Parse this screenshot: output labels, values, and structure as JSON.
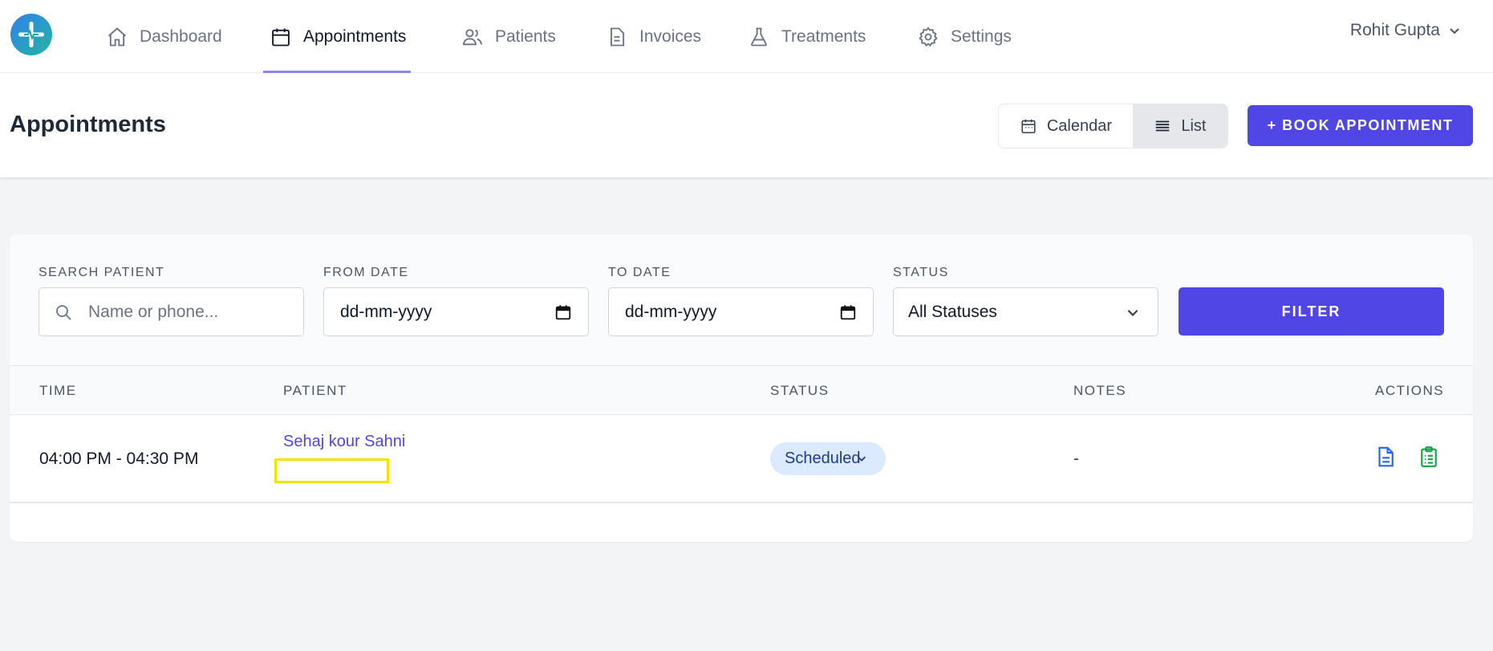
{
  "nav": {
    "items": [
      {
        "label": "Dashboard",
        "icon": "home-icon"
      },
      {
        "label": "Appointments",
        "icon": "calendar-icon",
        "active": true
      },
      {
        "label": "Patients",
        "icon": "users-icon"
      },
      {
        "label": "Invoices",
        "icon": "document-icon"
      },
      {
        "label": "Treatments",
        "icon": "flask-icon"
      },
      {
        "label": "Settings",
        "icon": "gear-icon"
      }
    ],
    "user_name": "Rohit Gupta"
  },
  "header": {
    "title": "Appointments",
    "view_calendar": "Calendar",
    "view_list": "List",
    "book_button": "+ BOOK APPOINTMENT"
  },
  "filters": {
    "search_label": "SEARCH PATIENT",
    "search_placeholder": "Name or phone...",
    "from_label": "FROM DATE",
    "from_value": "dd-mm-yyyy",
    "to_label": "TO DATE",
    "to_value": "dd-mm-yyyy",
    "status_label": "STATUS",
    "status_value": "All Statuses",
    "filter_button": "FILTER"
  },
  "table": {
    "columns": [
      "TIME",
      "PATIENT",
      "STATUS",
      "NOTES",
      "ACTIONS"
    ],
    "rows": [
      {
        "time": "04:00 PM - 04:30 PM",
        "patient": "Sehaj kour Sahni",
        "status": "Scheduled",
        "notes": "-"
      }
    ]
  },
  "colors": {
    "accent": "#4f46e5",
    "highlight": "#f2e600",
    "status_bg": "#dbeafe"
  }
}
